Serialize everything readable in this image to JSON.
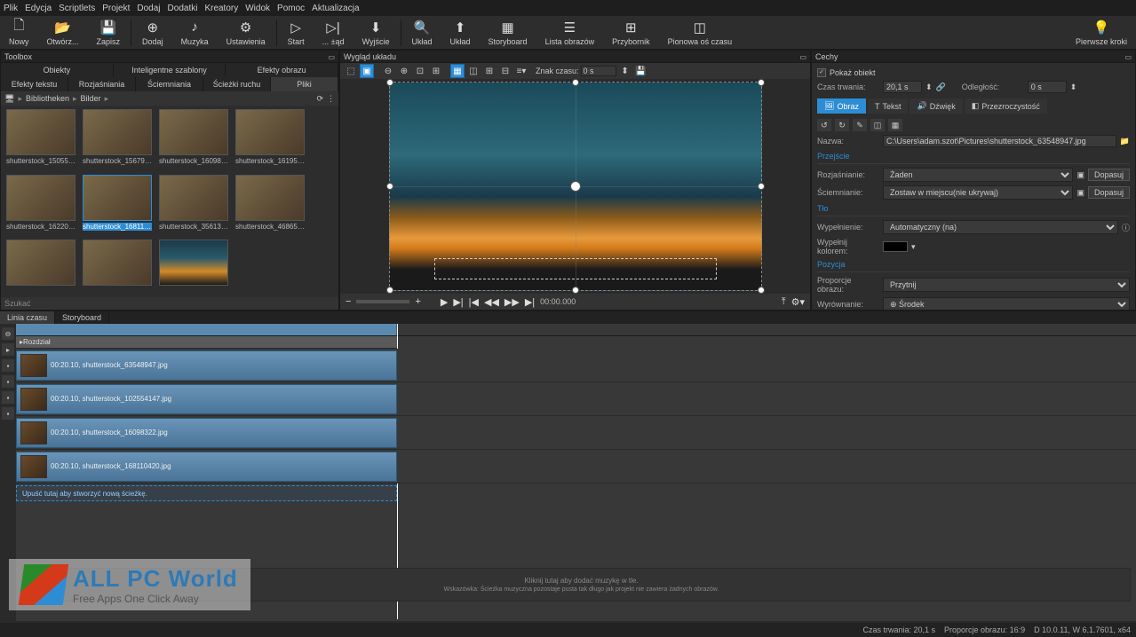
{
  "menu": [
    "Plik",
    "Edycja",
    "Scriptlets",
    "Projekt",
    "Dodaj",
    "Dodatki",
    "Kreatory",
    "Widok",
    "Pomoc",
    "Aktualizacja"
  ],
  "toolbar": [
    {
      "icon": "🗋",
      "label": "Nowy"
    },
    {
      "icon": "📂",
      "label": "Otwórz..."
    },
    {
      "icon": "💾",
      "label": "Zapisz"
    },
    {
      "sep": true
    },
    {
      "icon": "⊕",
      "label": "Dodaj"
    },
    {
      "icon": "♪",
      "label": "Muzyka"
    },
    {
      "icon": "⚙",
      "label": "Ustawienia"
    },
    {
      "sep": true
    },
    {
      "icon": "▷",
      "label": "Start"
    },
    {
      "icon": "▷|",
      "label": "... ±ąd"
    },
    {
      "icon": "⬇",
      "label": "Wyjście"
    },
    {
      "sep": true
    },
    {
      "icon": "🔍",
      "label": "Układ"
    },
    {
      "icon": "⬆",
      "label": "Układ"
    },
    {
      "icon": "▦",
      "label": "Storyboard"
    },
    {
      "icon": "☰",
      "label": "Lista obrazów"
    },
    {
      "icon": "⊞",
      "label": "Przybornik"
    },
    {
      "icon": "◫",
      "label": "Pionowa oś czasu"
    }
  ],
  "firstSteps": "Pierwsze kroki",
  "toolbox": {
    "title": "Toolbox",
    "tabs1": [
      "Obiekty",
      "Inteligentne szablony",
      "Efekty obrazu"
    ],
    "tabs2": [
      "Efekty tekstu",
      "Rozjaśniania",
      "Ściemniania",
      "Ścieżki ruchu",
      "Pliki"
    ],
    "activeTab": "Pliki",
    "breadcrumb": [
      "Bibliotheken",
      "Bilder"
    ],
    "search": "Szukać",
    "thumbs": [
      {
        "cap": "shutterstock_150550..."
      },
      {
        "cap": "shutterstock_156796..."
      },
      {
        "cap": "shutterstock_16098322"
      },
      {
        "cap": "shutterstock_161958..."
      },
      {
        "cap": "shutterstock_162201..."
      },
      {
        "cap": "shutterstock_168110...",
        "sel": true
      },
      {
        "cap": "shutterstock_35613667"
      },
      {
        "cap": "shutterstock_46865710"
      },
      {
        "cap": ""
      },
      {
        "cap": ""
      },
      {
        "cap": "",
        "aurora": true
      }
    ]
  },
  "preview": {
    "title": "Wygląd układu",
    "timeLabel": "Znak czasu:",
    "timeVal": "0 s",
    "zoomMinus": "−",
    "zoomPlus": "+",
    "playTime": "00:00.000"
  },
  "props": {
    "title": "Cechy",
    "showObject": "Pokaż obiekt",
    "durationLbl": "Czas trwania:",
    "durationVal": "20,1 s",
    "distanceLbl": "Odległość:",
    "distanceVal": "0 s",
    "tabs": [
      "Obraz",
      "Tekst",
      "Dźwięk",
      "Przezroczystość"
    ],
    "nameLbl": "Nazwa:",
    "nameVal": "C:\\Users\\adam.szot\\Pictures\\shutterstock_63548947.jpg",
    "secTransition": "Przejście",
    "fadeInLbl": "Rozjaśnianie:",
    "fadeInVal": "Żaden",
    "matchBtn": "Dopasuj",
    "fadeOutLbl": "Ściemnianie:",
    "fadeOutVal": "Zostaw w miejscu(nie ukrywaj)",
    "secBg": "Tło",
    "fillLbl": "Wypełnienie:",
    "fillVal": "Automatyczny (na)",
    "fillColorLbl": "Wypełnij kolorem:",
    "secPos": "Pozycja",
    "aspectLbl": "Proporcje obrazu:",
    "aspectVal": "Przytnij",
    "alignLbl": "Wyrównanie:",
    "alignVal": "⊕  Środek"
  },
  "timeline": {
    "tabs": [
      "Linia czasu",
      "Storyboard"
    ],
    "section": "Rozdział",
    "tracks": [
      {
        "dur": "00:20.10,",
        "name": "shutterstock_63548947.jpg"
      },
      {
        "dur": "00:20.10,",
        "name": "shutterstock_102554147.jpg"
      },
      {
        "dur": "00:20.10,",
        "name": "shutterstock_16098322.jpg"
      },
      {
        "dur": "00:20.10,",
        "name": "shutterstock_168110420.jpg"
      }
    ],
    "dropHint": "Upuść tutaj aby stworzyć nową ścieżkę.",
    "musicHint1": "Kliknij tutaj aby dodać muzykę w tle.",
    "musicHint2": "Wskazówka: Ścieżka muzyczna pozostaje pusta tak długo jak projekt nie zawiera żadnych obrazów."
  },
  "status": {
    "dur": "Czas trwania: 20,1 s",
    "aspect": "Proporcje obrazu: 16:9",
    "res": "D 10.0.11, W 6.1.7601, x64"
  },
  "watermark": {
    "title": "ALL PC World",
    "sub": "Free Apps One Click Away"
  }
}
